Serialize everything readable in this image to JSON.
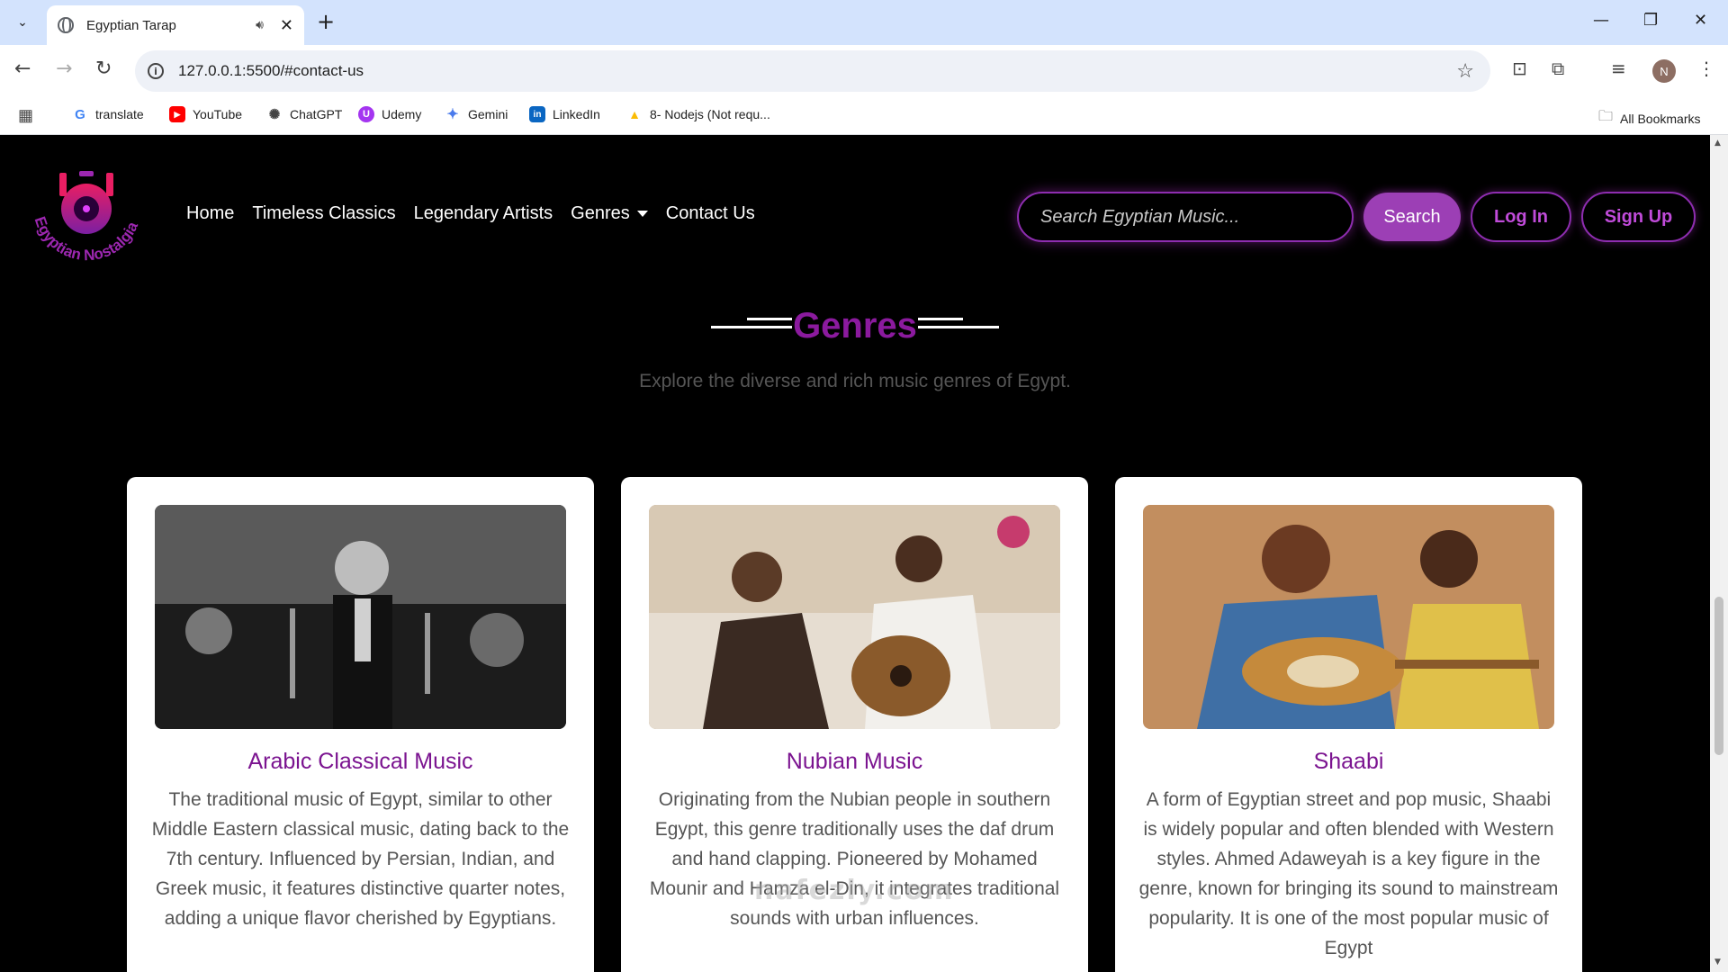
{
  "browser": {
    "tab_title": "Egyptian Tarap",
    "url": "127.0.0.1:5500/#contact-us",
    "profile_initial": "N",
    "bookmarks": [
      {
        "label": "translate",
        "color": "#4285f4",
        "glyph": "G"
      },
      {
        "label": "YouTube",
        "color": "#ff0000",
        "glyph": "▶"
      },
      {
        "label": "ChatGPT",
        "color": "#444444",
        "glyph": "✺"
      },
      {
        "label": "Udemy",
        "color": "#a435f0",
        "glyph": "U"
      },
      {
        "label": "Gemini",
        "color": "#4b7bec",
        "glyph": "✦"
      },
      {
        "label": "LinkedIn",
        "color": "#0a66c2",
        "glyph": "in"
      },
      {
        "label": "8- Nodejs (Not requ...",
        "color": "#fbbc04",
        "glyph": "▲"
      }
    ],
    "all_bookmarks_label": "All Bookmarks"
  },
  "site": {
    "logo_text": "Egyptian Nostalgia",
    "nav": {
      "home": "Home",
      "classics": "Timeless Classics",
      "artists": "Legendary Artists",
      "genres": "Genres",
      "contact": "Contact Us"
    },
    "search_placeholder": "Search Egyptian Music...",
    "search_button": "Search",
    "login_button": "Log In",
    "signup_button": "Sign Up"
  },
  "section": {
    "title": "Genres",
    "subtitle": "Explore the diverse and rich music genres of Egypt."
  },
  "cards": [
    {
      "title": "Arabic Classical Music",
      "text": "The traditional music of Egypt, similar to other Middle Eastern classical music, dating back to the 7th century. Influenced by Persian, Indian, and Greek music, it features distinctive quarter notes, adding a unique flavor cherished by Egyptians."
    },
    {
      "title": "Nubian Music",
      "text": "Originating from the Nubian people in southern Egypt, this genre traditionally uses the daf drum and hand clapping. Pioneered by Mohamed Mounir and Hamza el-Din, it integrates traditional sounds with urban influences."
    },
    {
      "title": "Shaabi",
      "text": "A form of Egyptian street and pop music, Shaabi is widely popular and often blended with Western styles. Ahmed Adaweyah is a key figure in the genre, known for bringing its sound to mainstream popularity. It is one of the most popular music of Egypt"
    }
  ],
  "watermark": "nafezly.com",
  "colors": {
    "accent": "#9c27b0",
    "title_purple": "#8b1a9e",
    "card_title": "#7b1490"
  }
}
